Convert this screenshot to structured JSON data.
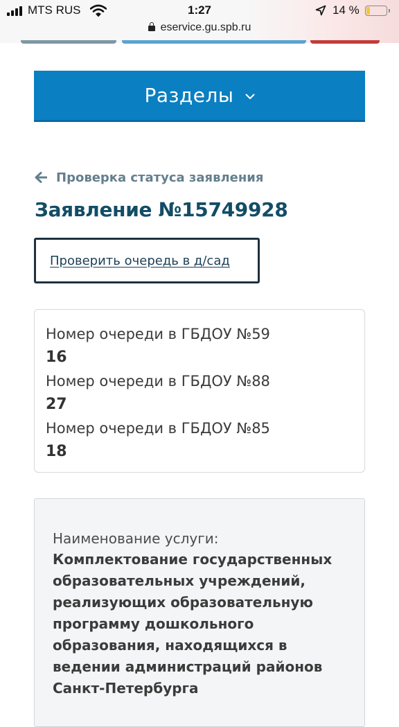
{
  "status_bar": {
    "carrier": "MTS RUS",
    "time": "1:27",
    "battery_percent": "14 %",
    "url": "eservice.gu.spb.ru"
  },
  "colors": {
    "accent": "#0a7fc2",
    "title": "#134d66",
    "back_link": "#647f8d",
    "battery_low": "#f5c53b"
  },
  "icons": {
    "signal": "signal-icon",
    "wifi": "wifi-icon",
    "location": "location-arrow-icon",
    "battery": "battery-icon",
    "lock": "lock-icon",
    "sections_chevron": "chevron-down-icon",
    "back": "arrow-left-icon"
  },
  "nav": {
    "sections_label": "Разделы"
  },
  "breadcrumb": {
    "back_label": "Проверка статуса заявления"
  },
  "application": {
    "title": "Заявление №15749928",
    "queue_button_label": "Проверить очередь в д/сад"
  },
  "queue": {
    "entries": [
      {
        "label": "Номер очереди в ГБДОУ №59",
        "value": "16"
      },
      {
        "label": "Номер очереди в ГБДОУ №88",
        "value": "27"
      },
      {
        "label": "Номер очереди в ГБДОУ №85",
        "value": "18"
      }
    ]
  },
  "service": {
    "label": "Наименование услуги:",
    "name": "Комплектование государственных\nобразовательных учреждений,\nреализующих образовательную\nпрограмму дошкольного\nобразования, находящихся в\nведении администраций районов\nСанкт-Петербурга"
  }
}
